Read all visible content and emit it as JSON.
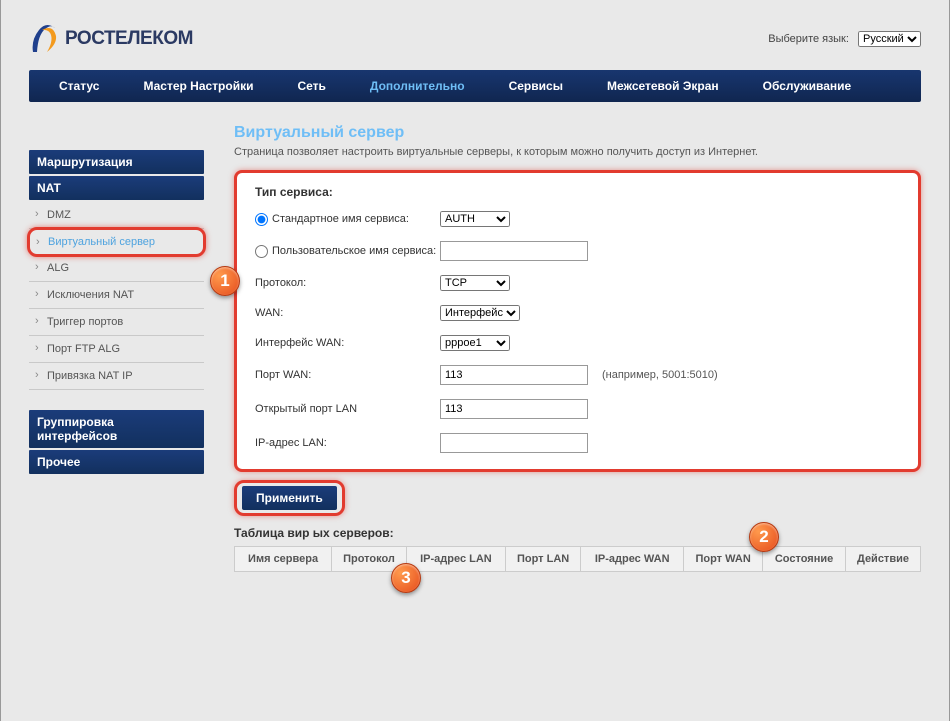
{
  "brand": "РОСТЕЛЕКОМ",
  "lang": {
    "label": "Выберите язык:",
    "value": "Русский"
  },
  "nav": {
    "status": "Статус",
    "wizard": "Мастер Настройки",
    "network": "Сеть",
    "advanced": "Дополнительно",
    "services": "Сервисы",
    "firewall": "Межсетевой Экран",
    "maintenance": "Обслуживание"
  },
  "sidebar": {
    "routing": "Маршрутизация",
    "nat": "NAT",
    "nat_items": {
      "dmz": "DMZ",
      "virtual_server": "Виртуальный сервер",
      "alg": "ALG",
      "nat_exceptions": "Исключения NAT",
      "port_trigger": "Триггер портов",
      "ftp_alg_port": "Порт FTP ALG",
      "nat_ip_binding": "Привязка NAT IP"
    },
    "if_grouping": "Группировка интерфейсов",
    "other": "Прочее"
  },
  "page": {
    "title": "Виртуальный сервер",
    "desc": "Страница позволяет настроить виртуальные серверы, к которым можно получить доступ из Интернет."
  },
  "form": {
    "service_type": "Тип сервиса:",
    "std_service_name": "Стандартное имя сервиса:",
    "custom_service_name": "Пользовательское имя сервиса:",
    "protocol": "Протокол:",
    "wan": "WAN:",
    "wan_interface": "Интерфейс WAN:",
    "wan_port": "Порт WAN:",
    "wan_port_hint": "(например, 5001:5010)",
    "lan_open_port": "Открытый порт LAN",
    "lan_ip": "IP-адрес LAN:",
    "values": {
      "std_service": "AUTH",
      "custom_service": "",
      "protocol": "TCP",
      "wan": "Интерфейс",
      "wan_interface": "pppoe1",
      "wan_port": "113",
      "lan_open_port": "113",
      "lan_ip": ""
    },
    "apply": "Применить"
  },
  "table": {
    "title": "Таблица вир              ых серверов:",
    "cols": {
      "server_name": "Имя сервера",
      "protocol": "Протокол",
      "lan_ip": "IP-адрес LAN",
      "lan_port": "Порт LAN",
      "wan_ip": "IP-адрес WAN",
      "wan_port": "Порт WAN",
      "state": "Состояние",
      "action": "Действие"
    }
  },
  "badges": {
    "b1": "1",
    "b2": "2",
    "b3": "3"
  }
}
